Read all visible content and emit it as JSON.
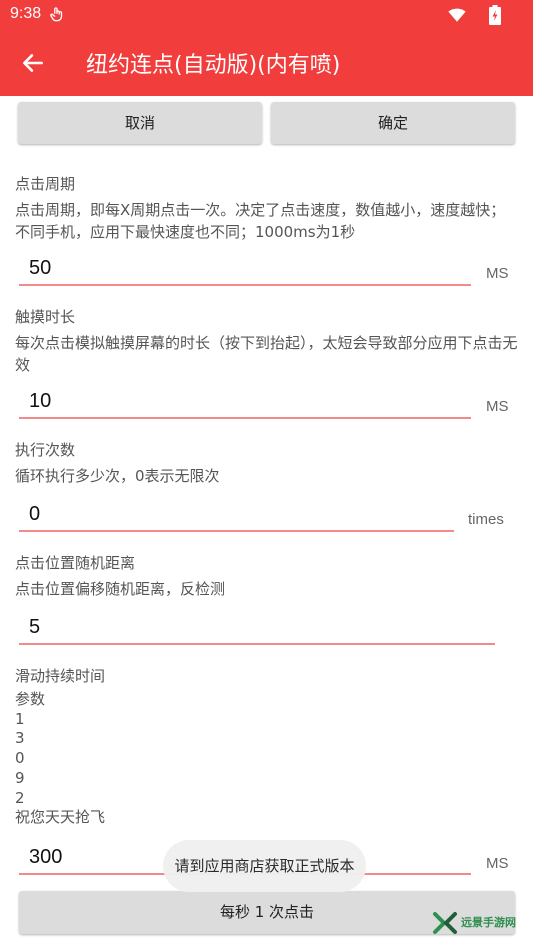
{
  "status_bar": {
    "time": "9:38"
  },
  "app_bar": {
    "title": "纽约连点(自动版)(内有喷)"
  },
  "dialog_buttons": {
    "cancel": "取消",
    "ok": "确定"
  },
  "settings": {
    "period": {
      "label": "点击周期",
      "description": "点击周期，即每X周期点击一次。决定了点击速度，数值越小，速度越快；不同手机，应用下最快速度也不同；1000ms为1秒",
      "value": "50",
      "unit": "MS"
    },
    "touch_duration": {
      "label": "触摸时长",
      "description": "每次点击模拟触摸屏幕的时长（按下到抬起），太短会导致部分应用下点击无效",
      "value": "10",
      "unit": "MS"
    },
    "repeat_count": {
      "label": "执行次数",
      "description": "循环执行多少次，0表示无限次",
      "value": "0",
      "unit": "times"
    },
    "random_offset": {
      "label": "点击位置随机距离",
      "description": "点击位置偏移随机距离，反检测",
      "value": "5"
    },
    "swipe_duration": {
      "label": "滑动持续时间",
      "params_title": "参数",
      "params": [
        "1",
        "3",
        "0",
        "9",
        "2"
      ],
      "wish": "祝您天天抢飞",
      "value": "300",
      "unit": "MS"
    }
  },
  "toast": "请到应用商店获取正式版本",
  "bottom_button": "每秒 1 次点击",
  "watermark": {
    "text": "远景手游网"
  }
}
